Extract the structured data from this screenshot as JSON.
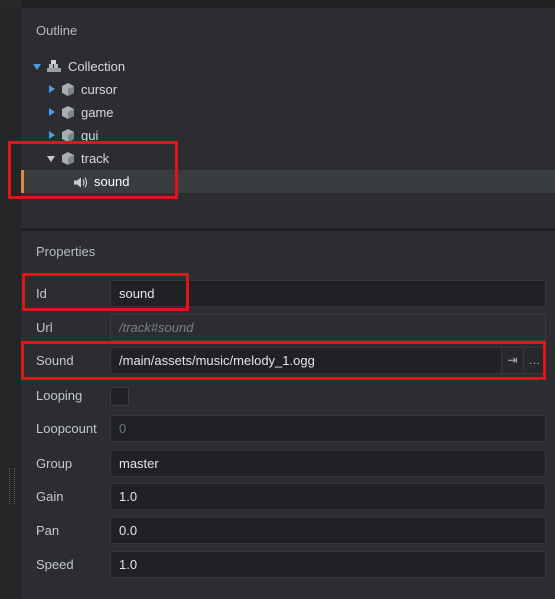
{
  "outline": {
    "title": "Outline",
    "tree": {
      "root": "Collection",
      "items": [
        {
          "label": "cursor",
          "expanded": false
        },
        {
          "label": "game",
          "expanded": false
        },
        {
          "label": "gui",
          "expanded": false
        },
        {
          "label": "track",
          "expanded": true
        },
        {
          "label": "sound",
          "selected": true
        }
      ]
    }
  },
  "properties": {
    "title": "Properties",
    "id": {
      "label": "Id",
      "value": "sound"
    },
    "url": {
      "label": "Url",
      "value": "/track#sound"
    },
    "sound": {
      "label": "Sound",
      "value": "/main/assets/music/melody_1.ogg",
      "goto_icon": "⇥",
      "browse_icon": "…"
    },
    "looping": {
      "label": "Looping",
      "checked": false
    },
    "loopcount": {
      "label": "Loopcount",
      "value": "0"
    },
    "group": {
      "label": "Group",
      "value": "master"
    },
    "gain": {
      "label": "Gain",
      "value": "1.0"
    },
    "pan": {
      "label": "Pan",
      "value": "0.0"
    },
    "speed": {
      "label": "Speed",
      "value": "1.0"
    }
  },
  "colors": {
    "highlight": "#e3131c",
    "selection_accent": "#e08a3c",
    "tree_arrow": "#4d9be0"
  }
}
